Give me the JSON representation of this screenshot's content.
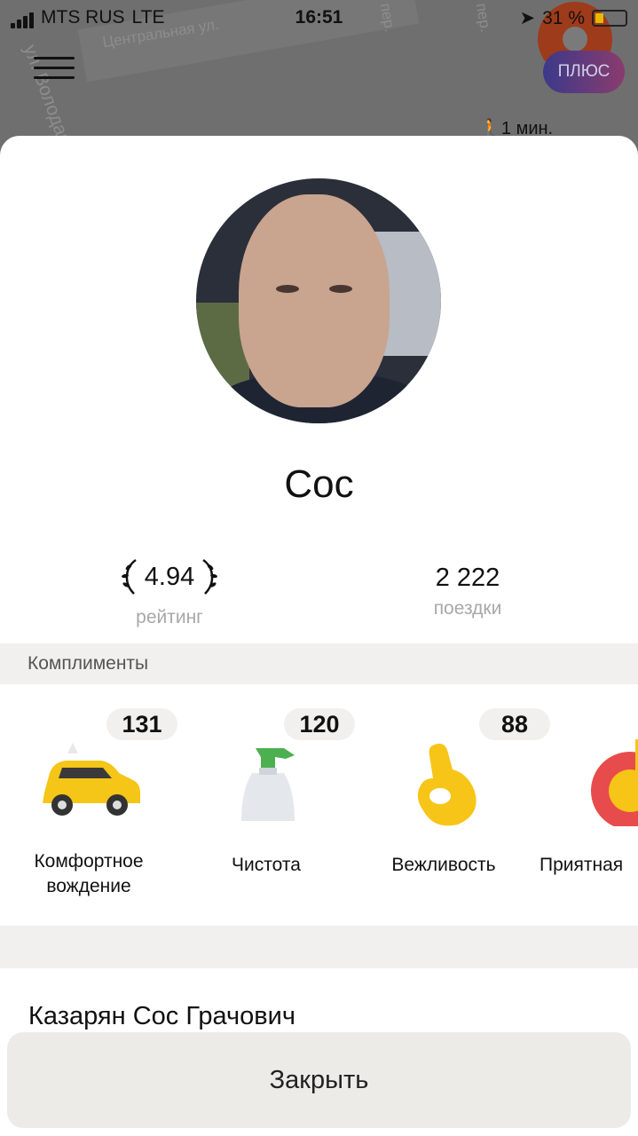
{
  "status_bar": {
    "carrier": "MTS RUS",
    "network": "LTE",
    "time": "16:51",
    "battery": "31 %"
  },
  "map": {
    "streets": [
      "Центральная ул.",
      "ул. Володарс",
      "пер.",
      "пер."
    ],
    "plus_badge": "ПЛЮС",
    "walk_time": "1 мин."
  },
  "driver": {
    "name": "Сос",
    "full_name": "Казарян Сос Грачович",
    "rating": "4.94",
    "rating_label": "рейтинг",
    "trips": "2 222",
    "trips_label": "поездки"
  },
  "compliments": {
    "title": "Комплименты",
    "items": [
      {
        "count": "131",
        "label": "Комфортное вождение",
        "icon": "taxi-car-icon"
      },
      {
        "count": "120",
        "label": "Чистота",
        "icon": "spray-bottle-icon"
      },
      {
        "count": "88",
        "label": "Вежливость",
        "icon": "ok-hand-icon"
      },
      {
        "count": "",
        "label": "Приятная",
        "icon": "music-note-icon"
      }
    ]
  },
  "actions": {
    "close_label": "Закрыть"
  },
  "colors": {
    "accent_yellow": "#f5c518",
    "section_bg": "#f1f0ee"
  }
}
